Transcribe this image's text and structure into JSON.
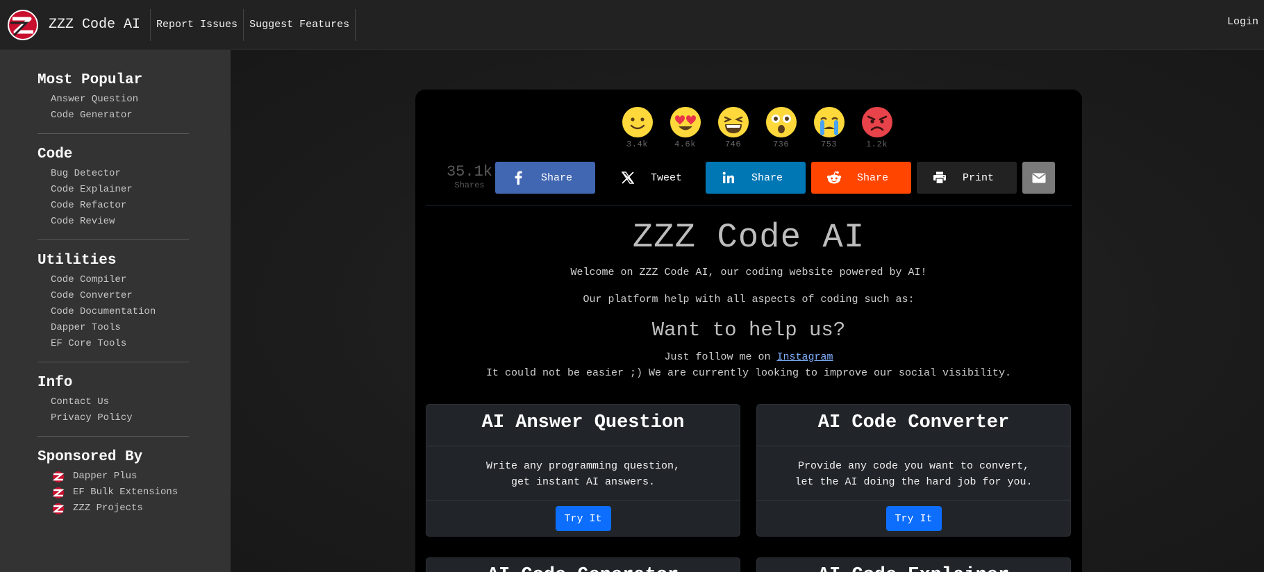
{
  "brand": {
    "name": "ZZZ Code AI"
  },
  "nav": {
    "report_issues": "Report Issues",
    "suggest_features": "Suggest Features",
    "login": "Login"
  },
  "sidebar": {
    "sections": [
      {
        "title": "Most Popular",
        "items": [
          "Answer Question",
          "Code Generator"
        ]
      },
      {
        "title": "Code",
        "items": [
          "Bug Detector",
          "Code Explainer",
          "Code Refactor",
          "Code Review"
        ]
      },
      {
        "title": "Utilities",
        "items": [
          "Code Compiler",
          "Code Converter",
          "Code Documentation",
          "Dapper Tools",
          "EF Core Tools"
        ]
      },
      {
        "title": "Info",
        "items": [
          "Contact Us",
          "Privacy Policy"
        ]
      },
      {
        "title": "Sponsored By",
        "items": [
          "Dapper Plus",
          "EF Bulk Extensions",
          "ZZZ Projects"
        ]
      }
    ]
  },
  "reactions": [
    {
      "icon": "smile-emoji-icon",
      "count": "3.4k"
    },
    {
      "icon": "heart-eyes-emoji-icon",
      "count": "4.6k"
    },
    {
      "icon": "laughing-emoji-icon",
      "count": "746"
    },
    {
      "icon": "surprised-emoji-icon",
      "count": "736"
    },
    {
      "icon": "crying-emoji-icon",
      "count": "753"
    },
    {
      "icon": "angry-emoji-icon",
      "count": "1.2k"
    }
  ],
  "shares": {
    "total": "35.1k",
    "label": "Shares",
    "buttons": {
      "facebook": "Share",
      "twitter": "Tweet",
      "linkedin": "Share",
      "reddit": "Share",
      "print": "Print"
    }
  },
  "hero": {
    "title": "ZZZ Code AI",
    "welcome": "Welcome on ZZZ Code AI, our coding website powered by AI!",
    "platform": "Our platform help with all aspects of coding such as:",
    "help_title": "Want to help us?",
    "follow_prefix": "Just follow me on ",
    "follow_link": "Instagram",
    "easier": "It could not be easier ;) We are currently looking to improve our social visibility."
  },
  "tools": [
    {
      "title": "AI Answer Question",
      "line1": "Write any programming question,",
      "line2": "get instant AI answers.",
      "button": "Try It"
    },
    {
      "title": "AI Code Converter",
      "line1": "Provide any code you want to convert,",
      "line2": "let the AI doing the hard job for you.",
      "button": "Try It"
    }
  ],
  "peek_tools": [
    {
      "title": "AI Code Generator"
    },
    {
      "title": "AI Code Explainer"
    }
  ],
  "colors": {
    "facebook": "#4267b2",
    "linkedin": "#0077b5",
    "reddit": "#ff4500",
    "primary_button": "#0d6efd"
  }
}
